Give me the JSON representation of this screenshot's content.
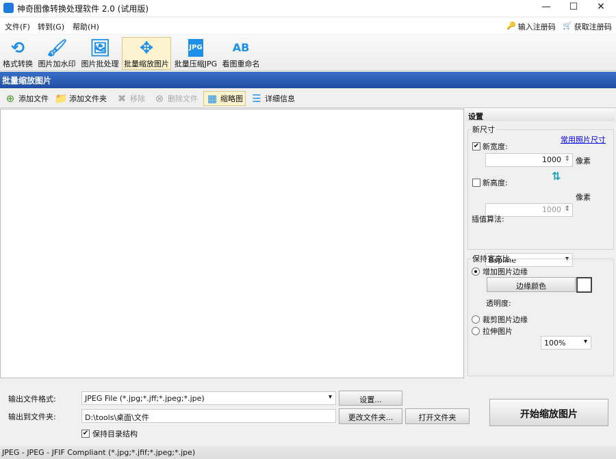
{
  "window": {
    "title": "神奇图像转换处理软件 2.0 (试用版)",
    "minimize": "—",
    "maximize": "☐",
    "close": "✕"
  },
  "menu": [
    "文件(F)",
    "转到(G)",
    "帮助(H)"
  ],
  "register": {
    "enter_code": "输入注册码",
    "get_code": "获取注册码"
  },
  "toolbar": [
    {
      "label": "格式转换",
      "icon": "convert-icon"
    },
    {
      "label": "图片加水印",
      "icon": "brush-icon"
    },
    {
      "label": "图片批处理",
      "icon": "image-icon"
    },
    {
      "label": "批量缩放图片",
      "icon": "move-arrows-icon"
    },
    {
      "label": "批量压缩JPG",
      "icon": "jpg-file-icon"
    },
    {
      "label": "看图重命名",
      "icon": "rename-icon"
    }
  ],
  "section_title": "批量缩放图片",
  "subtoolbar": {
    "add_file": "添加文件",
    "add_folder": "添加文件夹",
    "remove": "移除",
    "delete_file": "删除文件",
    "thumbnail": "缩略图",
    "details": "详细信息"
  },
  "settings": {
    "title": "设置",
    "new_size": "新尺寸",
    "common_sizes_link": "常用照片尺寸",
    "new_width_label": "新宽度:",
    "new_width_checked": true,
    "new_width": "1000",
    "unit": "像素",
    "new_height_label": "新高度:",
    "new_height_checked": false,
    "new_height": "1000",
    "interp_label": "插值算法:",
    "interp_value": "Bspline",
    "keep_ratio": "保持宽高比",
    "add_border": "增加图片边缘",
    "border_color_btn": "边缘颜色",
    "opacity_label": "透明度:",
    "opacity_value": "100%",
    "crop_border": "裁剪图片边缘",
    "stretch": "拉伸图片",
    "selected_mode": "add_border"
  },
  "output": {
    "format_label": "输出文件格式:",
    "format_value": "JPEG File (*.jpg;*.jff;*.jpeg;*.jpe)",
    "settings_btn": "设置...",
    "folder_label": "输出到文件夹:",
    "folder_value": "D:\\tools\\桌面\\文件",
    "change_folder_btn": "更改文件夹...",
    "open_folder_btn": "打开文件夹",
    "keep_structure": "保持目录结构",
    "keep_structure_checked": true,
    "start_btn": "开始缩放图片"
  },
  "status": "JPEG - JPEG - JFIF Compliant (*.jpg;*.jfif;*.jpeg;*.jpe)"
}
